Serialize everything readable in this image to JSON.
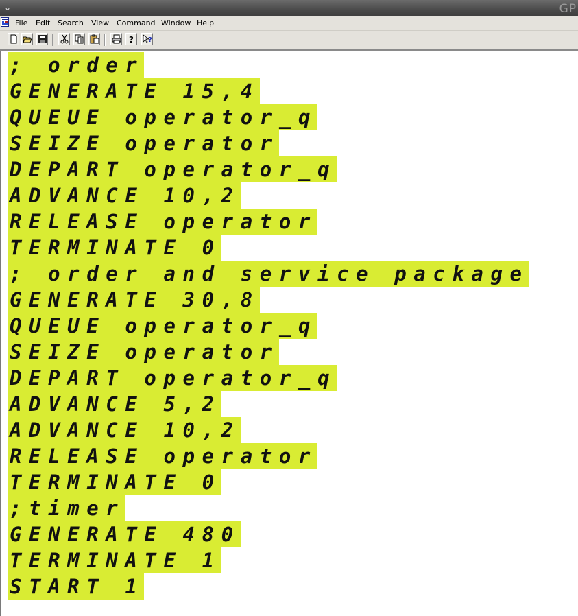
{
  "window": {
    "title": "GP",
    "menu_chevron": "⌄"
  },
  "menu": {
    "items": [
      "File",
      "Edit",
      "Search",
      "View",
      "Command",
      "Window",
      "Help"
    ]
  },
  "toolbar": {
    "buttons": [
      "new-file-icon",
      "open-folder-icon",
      "save-disk-icon",
      "cut-icon",
      "copy-icon",
      "paste-icon",
      "print-icon",
      "help-icon",
      "context-help-icon"
    ]
  },
  "editor": {
    "highlight_color": "#d9ec33",
    "lines": [
      "; order",
      "GENERATE 15,4",
      "QUEUE operator_q",
      "SEIZE operator",
      "DEPART operator_q",
      "ADVANCE 10,2",
      "RELEASE operator",
      "TERMINATE 0",
      "; order and service package",
      "GENERATE 30,8",
      "QUEUE operator_q",
      "SEIZE operator",
      "DEPART operator_q",
      "ADVANCE 5,2",
      "ADVANCE 10,2",
      "RELEASE operator",
      "TERMINATE 0",
      ";timer",
      "GENERATE 480",
      "TERMINATE 1",
      "START 1"
    ]
  }
}
